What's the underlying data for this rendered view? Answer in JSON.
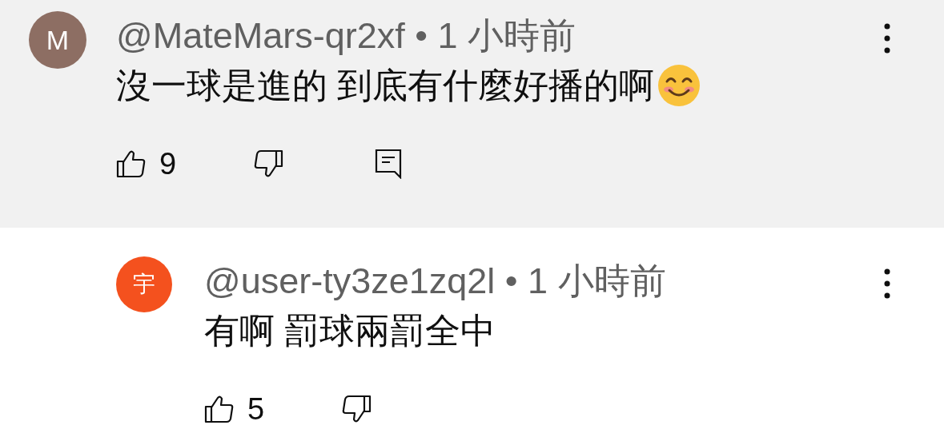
{
  "comments": [
    {
      "avatar": {
        "letter": "M",
        "color": "#8d6e63"
      },
      "author": "@MateMars-qr2xf",
      "time": "• 1 小時前",
      "text": "沒一球是進的 到底有什麼好播的啊",
      "emoji": true,
      "likes": "9",
      "highlighted": true,
      "reply_button": true,
      "is_reply": false
    },
    {
      "avatar": {
        "letter": "宇",
        "color": "#f4511e"
      },
      "author": "@user-ty3ze1zq2l",
      "time": "• 1 小時前",
      "text": "有啊 罰球兩罰全中",
      "emoji": false,
      "likes": "5",
      "highlighted": false,
      "reply_button": false,
      "is_reply": true
    }
  ]
}
